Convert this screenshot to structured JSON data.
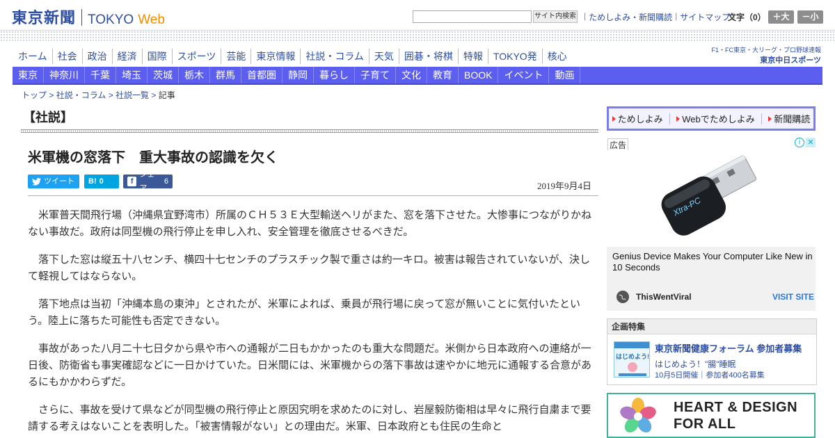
{
  "header": {
    "logo_kanji": "東京新聞",
    "logo_en": "TOKYO",
    "logo_web": "Web",
    "search_button": "サイト内検索",
    "util_links": [
      "ためしよみ・新聞購読",
      "サイトマップ"
    ],
    "font_size_label": "文字（0）",
    "font_plus": "＋大",
    "font_minus": "－小"
  },
  "nav_main": [
    "ホーム",
    "社会",
    "政治",
    "経済",
    "国際",
    "スポーツ",
    "芸能",
    "東京情報",
    "社説・コラム",
    "天気",
    "囲碁・将棋",
    "特報",
    "TOKYO発",
    "核心"
  ],
  "nav_region": [
    "東京",
    "神奈川",
    "千葉",
    "埼玉",
    "茨城",
    "栃木",
    "群馬",
    "首都圏",
    "静岡",
    "暮らし",
    "子育て",
    "文化",
    "教育",
    "BOOK",
    "イベント",
    "動画"
  ],
  "chunichi": {
    "top": "F1・FC東京・大リーグ・プロ野球速報",
    "bottom": "東京中日スポーツ"
  },
  "breadcrumb": {
    "items": [
      "トップ",
      "社説・コラム",
      "社説一覧"
    ],
    "current": "記事",
    "separator": ">"
  },
  "article": {
    "section": "【社説】",
    "headline": "米軍機の窓落下　重大事故の認識を欠く",
    "tweet_label": "ツイート",
    "hatena_label": "B!",
    "hatena_count": "0",
    "fb_label": "シェア",
    "fb_count": "6",
    "date": "2019年9月4日",
    "paragraphs": [
      "米軍普天間飛行場（沖縄県宜野湾市）所属のＣＨ５３Ｅ大型輸送ヘリがまた、窓を落下させた。大惨事につながりかねない事故だ。政府は同型機の飛行停止を申し入れ、安全管理を徹底させるべきだ。",
      "落下した窓は縦五十八センチ、横四十七センチのプラスチック製で重さは約一キロ。被害は報告されていないが、決して軽視してはならない。",
      "落下地点は当初「沖縄本島の東沖」とされたが、米軍によれば、乗員が飛行場に戻って窓が無いことに気付いたという。陸上に落ちた可能性も否定できない。",
      "事故があった八月二十七日夕から県や市への通報が二日もかかったのも重大な問題だ。米側から日本政府への連絡が一日後、防衛省も事実確認などに一日かけていた。日米間には、米軍機からの落下事故は速やかに地元に通報する合意があるにもかかわらずだ。",
      "さらに、事故を受けて県などが同型機の飛行停止と原因究明を求めたのに対し、岩屋毅防衛相は早々に飛行自粛まで要請する考えはないことを表明した。「被害情報がない」との理由だ。米軍、日本政府とも住民の生命と"
    ]
  },
  "sidebar": {
    "subscribe_links": [
      "ためしよみ",
      "Webでためしよみ",
      "新聞購読"
    ],
    "ad_label": "広告",
    "ad_product_text": "Xtra-PC",
    "ad_headline": "Genius Device Makes Your Computer Like New in 10 Seconds",
    "ad_source": "ThisWentViral",
    "ad_visit": "VISIT SITE",
    "feature_heading": "企画特集",
    "feature_title": "東京新聞健康フォーラム 参加者募集",
    "feature_sub": "はじめよう！\"腸\"睡眠",
    "feature_date": "10月5日開催｜参加者400名募集",
    "feature_thumb_text": "はじめよう!",
    "banner_line1": "HEART & DESIGN",
    "banner_line2": "FOR ALL"
  },
  "colors": {
    "brand_blue": "#2d4ea3",
    "web_orange": "#f08c00",
    "region_nav": "#5c5ef0",
    "twitter": "#1da1f2",
    "hatena": "#00a4de",
    "facebook": "#3b5998"
  }
}
